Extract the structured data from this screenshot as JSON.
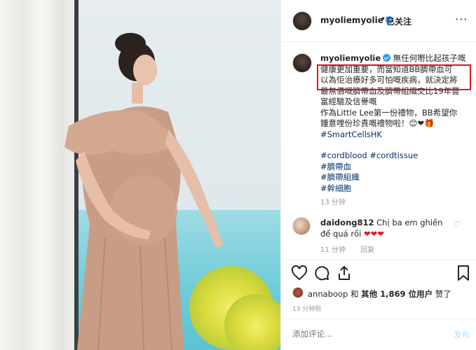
{
  "header": {
    "username": "myoliemyolie",
    "dot": "•",
    "follow_status": "已关注",
    "more": "···"
  },
  "caption": {
    "username": "myoliemyolie",
    "lines": [
      "無任何嘢比起孩子嘅",
      "健康更加重要，而當知道BB臍帶血可",
      "以為佢治療好多可怕嘅疾病，就決定將",
      "最無價嘅臍帶血及臍帶組織交比19年豐",
      "富經驗及信譽嘅",
      "作為Little Lee第一份禮物，BB希望你",
      "鍾意哩份珍貴嘅禮物啦！😊❤🎁"
    ],
    "tags_a": [
      "#SmartCellsHK"
    ],
    "tags_b": [
      "#cordblood #cordtissue",
      "#臍帶血",
      "#臍帶組織",
      "#幹細胞"
    ],
    "time": "13 分钟"
  },
  "comment": {
    "username": "daidong812",
    "text": "Chị ba em ghiền để quá rồi",
    "hearts": "❤❤❤",
    "time": "11 分钟",
    "reply": "回复"
  },
  "likes": {
    "user": "annaboop",
    "and": "和",
    "others_label": "其他",
    "count": "1,869",
    "suffix_bold": "位用户",
    "suffix": "赞了"
  },
  "post_time": "13 分钟前",
  "add_comment": {
    "placeholder": "添加评论...",
    "post_label": "发布"
  },
  "colors": {
    "highlight_box": "#e0181c",
    "verified": "#3897f0",
    "hashtag": "#003569"
  },
  "icons": [
    "heart-icon",
    "comment-icon",
    "share-icon",
    "bookmark-icon",
    "more-icon",
    "verified-icon"
  ]
}
